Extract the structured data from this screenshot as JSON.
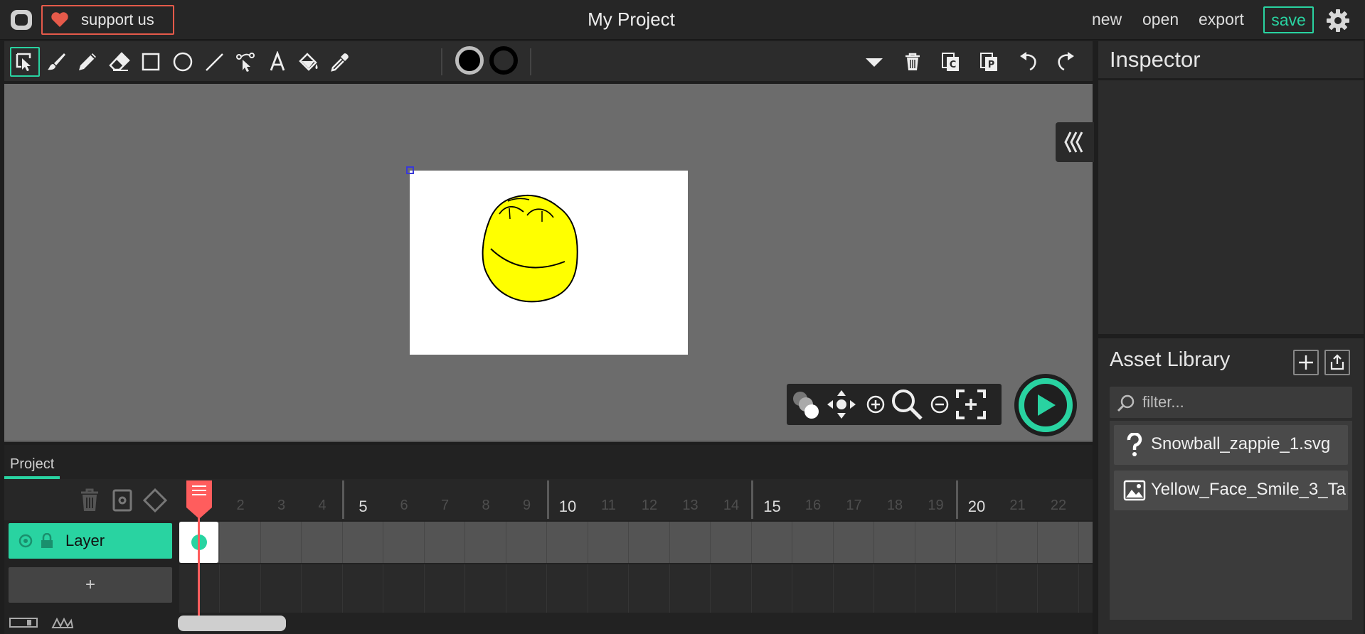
{
  "app": {
    "project_title": "My Project",
    "support_label": "support us",
    "menu": {
      "new": "new",
      "open": "open",
      "export": "export",
      "save": "save"
    }
  },
  "toolbar": {
    "tools": [
      "cursor",
      "brush",
      "pencil",
      "eraser",
      "rectangle",
      "ellipse",
      "line",
      "path-cursor",
      "text",
      "fill-bucket",
      "eyedropper"
    ],
    "active_tool": "cursor",
    "fill_color": "#000000",
    "stroke_color": "#000000",
    "actions": [
      "options-dropdown",
      "delete",
      "copy",
      "paste",
      "undo",
      "redo"
    ]
  },
  "canvas": {
    "stage_background": "#ffffff",
    "drawing": "yellow smiley face",
    "drawing_fill": "#ffff00"
  },
  "timeline": {
    "tab_label": "Project",
    "layer_name": "Layer",
    "add_layer_label": "+",
    "current_frame": 1,
    "frame_numbers": [
      "2",
      "3",
      "4",
      "5",
      "6",
      "7",
      "8",
      "9",
      "10",
      "11",
      "12",
      "13",
      "14",
      "15",
      "16",
      "17",
      "18",
      "19",
      "20",
      "21",
      "22",
      "2"
    ],
    "major_frames": [
      "5",
      "10",
      "15",
      "20"
    ],
    "keyframes": [
      1
    ]
  },
  "inspector": {
    "title": "Inspector"
  },
  "asset_library": {
    "title": "Asset Library",
    "filter_placeholder": "filter...",
    "items": [
      {
        "name": "Snowball_zappie_1.svg",
        "icon": "question-icon"
      },
      {
        "name": "Yellow_Face_Smile_3_Ta",
        "icon": "image-icon"
      }
    ]
  },
  "colors": {
    "accent": "#29d3a1",
    "support_border": "#e55a4a",
    "playhead": "#ff5d5d",
    "canvas_bg": "#6c6c6c"
  }
}
